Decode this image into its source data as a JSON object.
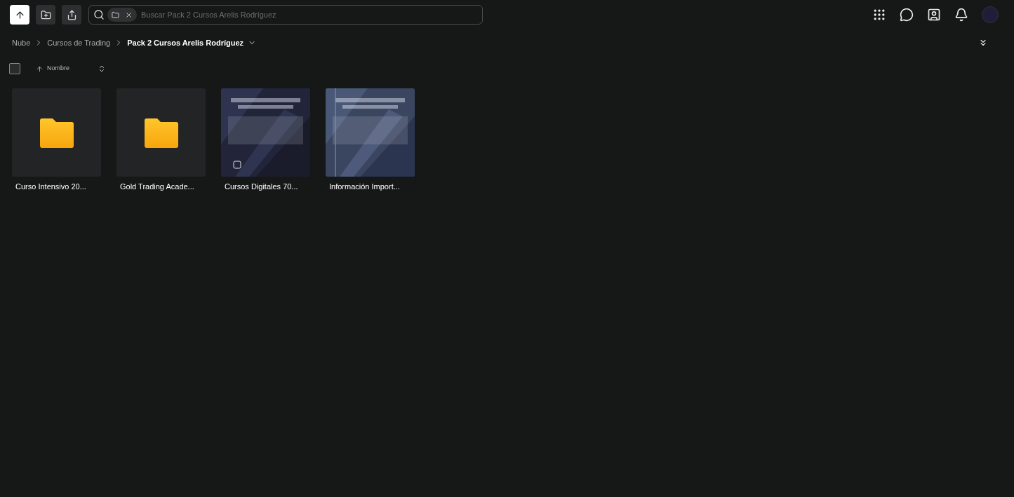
{
  "search": {
    "placeholder": "Buscar Pack 2 Cursos Arelis Rodríguez"
  },
  "breadcrumbs": [
    {
      "label": "Nube",
      "current": false
    },
    {
      "label": "Cursos de Trading",
      "current": false
    },
    {
      "label": "Pack 2 Cursos Arelis Rodríguez",
      "current": true
    }
  ],
  "sort": {
    "label": "Nombre"
  },
  "select_all": {
    "checked": false
  },
  "items": [
    {
      "kind": "folder",
      "name": "Curso Intensivo 20..."
    },
    {
      "kind": "folder",
      "name": "Gold Trading Acade..."
    },
    {
      "name": "Cursos Digitales 70..."
    },
    {
      "name": "Información Import..."
    }
  ]
}
